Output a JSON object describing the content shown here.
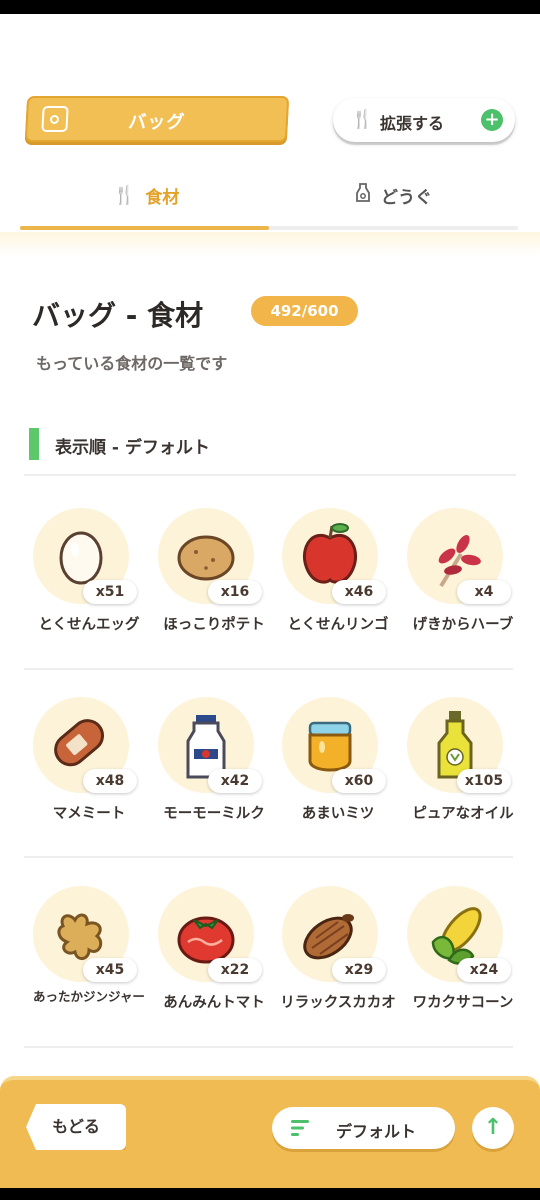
{
  "header": {
    "bag_tab_label": "バッグ",
    "expand_button_label": "拡張する"
  },
  "subtabs": [
    {
      "label": "食材",
      "icon": "fork-knife-icon",
      "active": true
    },
    {
      "label": "どうぐ",
      "icon": "bottle-icon",
      "active": false
    }
  ],
  "page": {
    "title": "バッグ - 食材",
    "count": "492/600",
    "subtitle": "もっている食材の一覧です",
    "sort_label": "表示順 - デフォルト"
  },
  "items": [
    {
      "name": "とくせんエッグ",
      "qty": "x51",
      "icon": "egg-icon"
    },
    {
      "name": "ほっこりポテト",
      "qty": "x16",
      "icon": "potato-icon"
    },
    {
      "name": "とくせんリンゴ",
      "qty": "x46",
      "icon": "apple-icon"
    },
    {
      "name": "げきからハーブ",
      "qty": "x4",
      "icon": "herb-icon"
    },
    {
      "name": "マメミート",
      "qty": "x48",
      "icon": "sausage-icon"
    },
    {
      "name": "モーモーミルク",
      "qty": "x42",
      "icon": "milk-bottle-icon"
    },
    {
      "name": "あまいミツ",
      "qty": "x60",
      "icon": "honey-jar-icon"
    },
    {
      "name": "ピュアなオイル",
      "qty": "x105",
      "icon": "oil-bottle-icon"
    },
    {
      "name": "あったかジンジャー",
      "qty": "x45",
      "icon": "ginger-icon"
    },
    {
      "name": "あんみんトマト",
      "qty": "x22",
      "icon": "tomato-icon"
    },
    {
      "name": "リラックスカカオ",
      "qty": "x29",
      "icon": "cacao-icon"
    },
    {
      "name": "ワカクサコーン",
      "qty": "x24",
      "icon": "corn-icon"
    }
  ],
  "bottom": {
    "back_label": "もどる",
    "sort_button_label": "デフォルト"
  },
  "colors": {
    "accent": "#f0bb52",
    "active_tab": "#e3a22a",
    "green": "#4cc06b"
  }
}
